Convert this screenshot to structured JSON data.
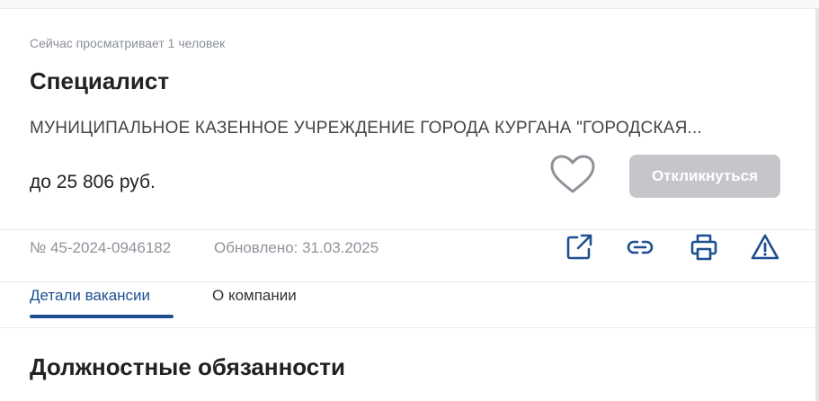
{
  "vacancy": {
    "viewers_text": "Сейчас просматривает 1 человек",
    "title": "Специалист",
    "company": "МУНИЦИПАЛЬНОЕ КАЗЕННОЕ УЧРЕЖДЕНИЕ ГОРОДА КУРГАНА \"ГОРОДСКАЯ...",
    "salary": "до 25 806 руб.",
    "respond_label": "Откликнуться",
    "number": "№ 45-2024-0946182",
    "updated": "Обновлено: 31.03.2025"
  },
  "tabs": [
    {
      "label": "Детали вакансии"
    },
    {
      "label": "О компании"
    }
  ],
  "section_title": "Должностные обязанности",
  "actions": [
    "external-link-icon",
    "link-icon",
    "print-icon",
    "warning-icon"
  ],
  "colors": {
    "accent": "#1d4f91",
    "button_disabled": "#c4c6ca",
    "muted": "#8e939b"
  }
}
